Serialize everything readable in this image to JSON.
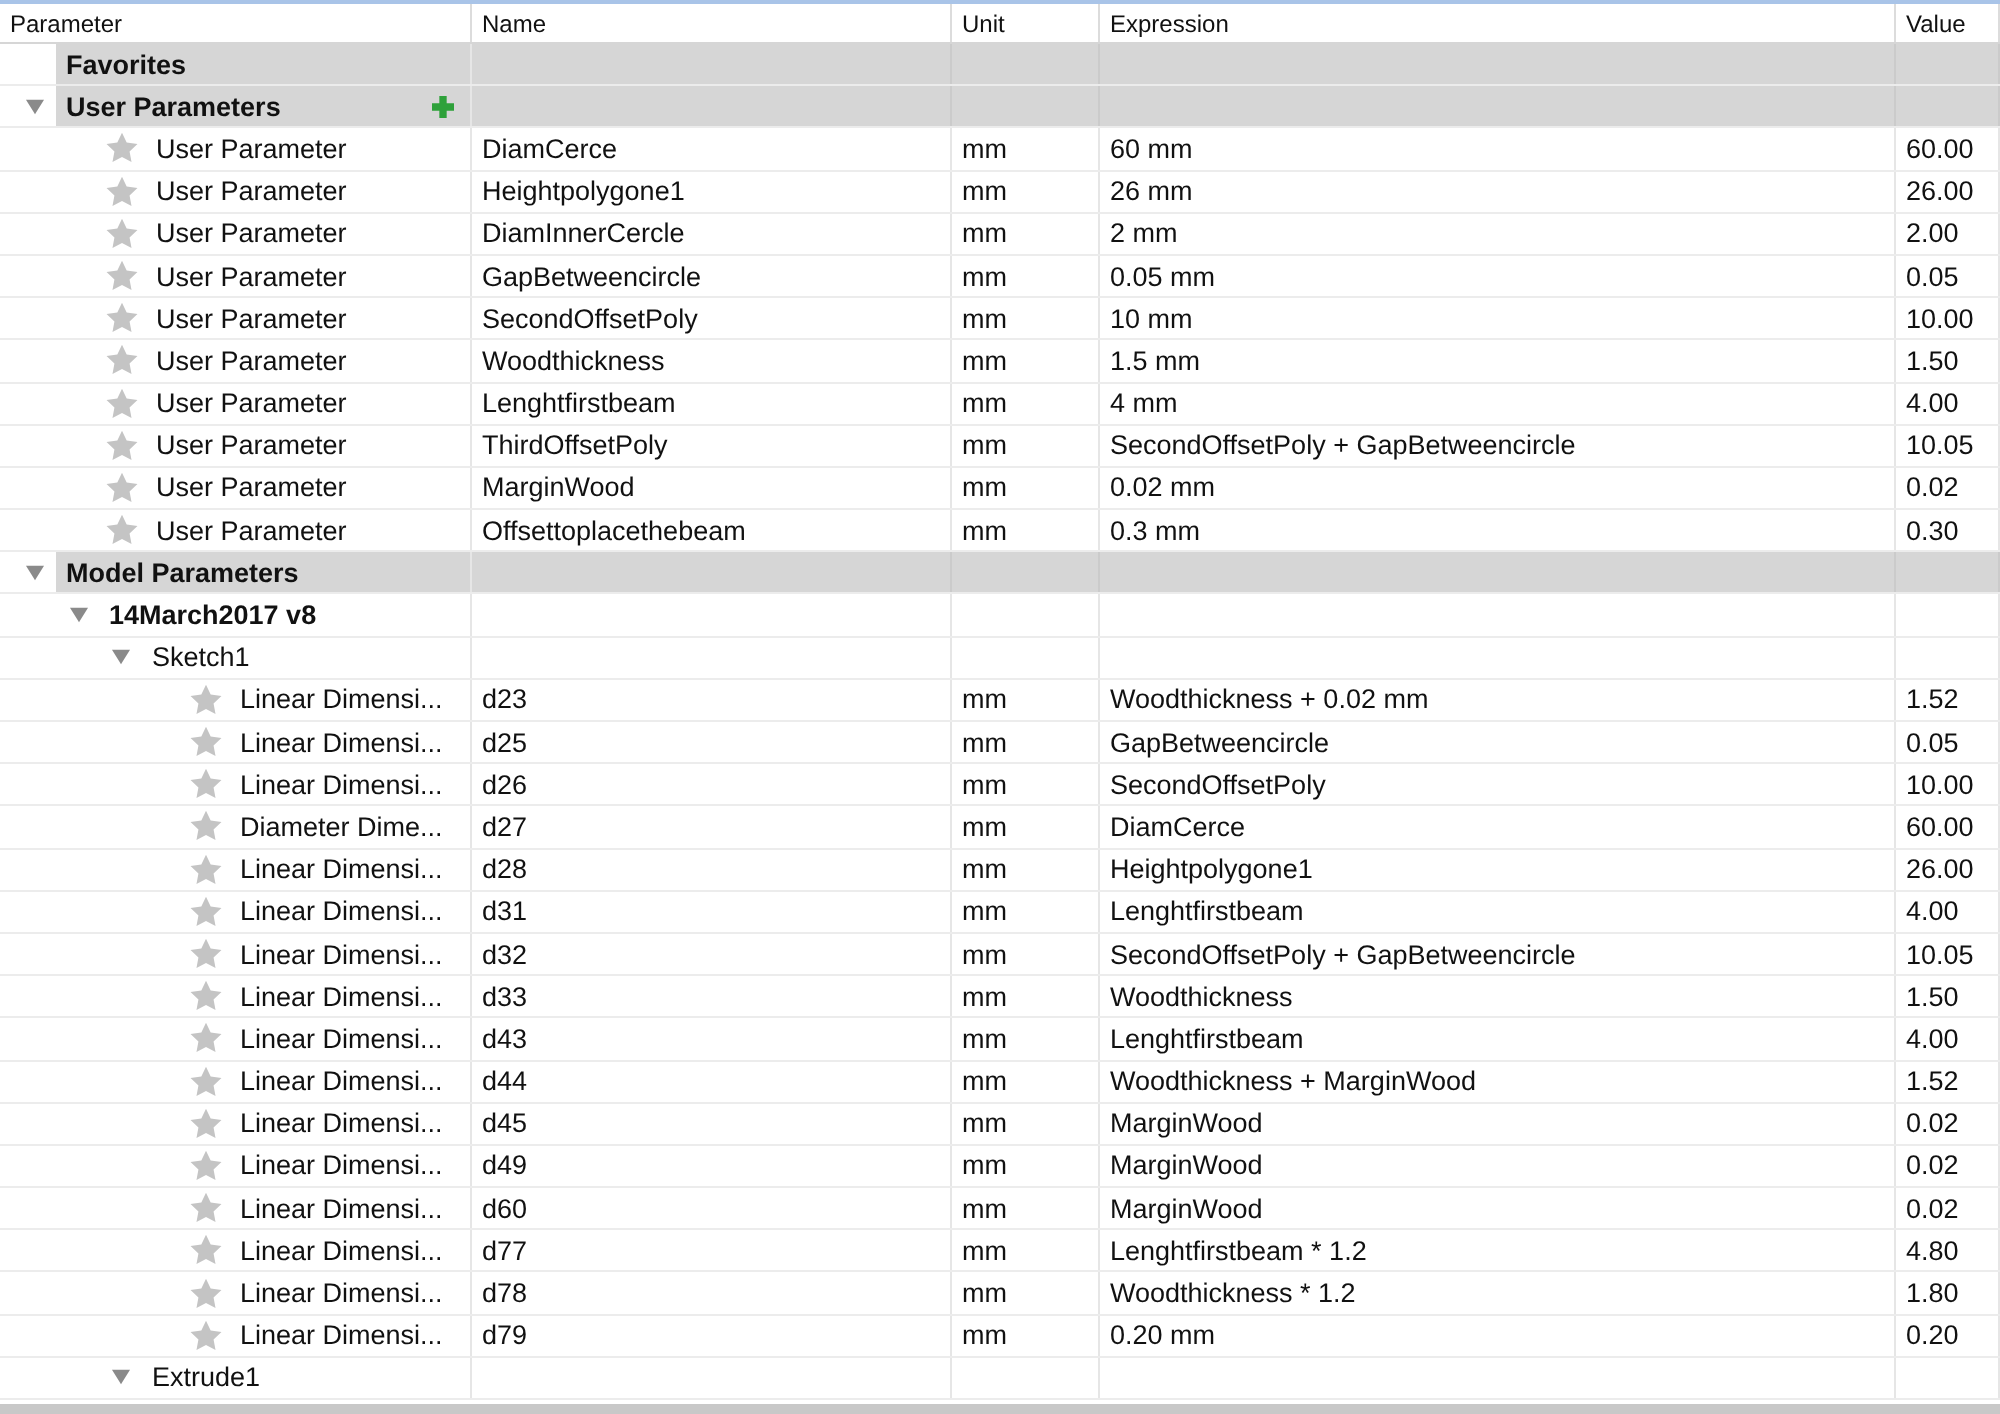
{
  "columns": [
    "Parameter",
    "Name",
    "Unit",
    "Expression",
    "Value"
  ],
  "tree": [
    {
      "kind": "section",
      "label": "Favorites"
    },
    {
      "kind": "section",
      "label": "User Parameters",
      "expanded": true,
      "add_button": true,
      "children": [
        {
          "kind": "param",
          "type": "User Parameter",
          "name": "DiamCerce",
          "unit": "mm",
          "expression": "60 mm",
          "value": "60.00",
          "favorite": false
        },
        {
          "kind": "param",
          "type": "User Parameter",
          "name": "Heightpolygone1",
          "unit": "mm",
          "expression": "26 mm",
          "value": "26.00",
          "favorite": false
        },
        {
          "kind": "param",
          "type": "User Parameter",
          "name": "DiamInnerCercle",
          "unit": "mm",
          "expression": "2 mm",
          "value": "2.00",
          "favorite": false
        },
        {
          "kind": "param",
          "type": "User Parameter",
          "name": "GapBetweencircle",
          "unit": "mm",
          "expression": "0.05 mm",
          "value": "0.05",
          "favorite": false
        },
        {
          "kind": "param",
          "type": "User Parameter",
          "name": "SecondOffsetPoly",
          "unit": "mm",
          "expression": "10 mm",
          "value": "10.00",
          "favorite": false
        },
        {
          "kind": "param",
          "type": "User Parameter",
          "name": "Woodthickness",
          "unit": "mm",
          "expression": "1.5 mm",
          "value": "1.50",
          "favorite": false
        },
        {
          "kind": "param",
          "type": "User Parameter",
          "name": "Lenghtfirstbeam",
          "unit": "mm",
          "expression": "4 mm",
          "value": "4.00",
          "favorite": false
        },
        {
          "kind": "param",
          "type": "User Parameter",
          "name": "ThirdOffsetPoly",
          "unit": "mm",
          "expression": "SecondOffsetPoly + GapBetweencircle",
          "value": "10.05",
          "favorite": false
        },
        {
          "kind": "param",
          "type": "User Parameter",
          "name": "MarginWood",
          "unit": "mm",
          "expression": "0.02 mm",
          "value": "0.02",
          "favorite": false
        },
        {
          "kind": "param",
          "type": "User Parameter",
          "name": "Offsettoplacethebeam",
          "unit": "mm",
          "expression": "0.3 mm",
          "value": "0.30",
          "favorite": false
        }
      ]
    },
    {
      "kind": "section",
      "label": "Model Parameters",
      "expanded": true,
      "children": [
        {
          "kind": "component",
          "label": "14March2017 v8",
          "expanded": true,
          "children": [
            {
              "kind": "feature",
              "label": "Sketch1",
              "expanded": true,
              "children": [
                {
                  "kind": "param",
                  "type": "Linear Dimensi...",
                  "name": "d23",
                  "unit": "mm",
                  "expression": "Woodthickness + 0.02 mm",
                  "value": "1.52",
                  "favorite": false
                },
                {
                  "kind": "param",
                  "type": "Linear Dimensi...",
                  "name": "d25",
                  "unit": "mm",
                  "expression": "GapBetweencircle",
                  "value": "0.05",
                  "favorite": false
                },
                {
                  "kind": "param",
                  "type": "Linear Dimensi...",
                  "name": "d26",
                  "unit": "mm",
                  "expression": "SecondOffsetPoly",
                  "value": "10.00",
                  "favorite": false
                },
                {
                  "kind": "param",
                  "type": "Diameter Dime...",
                  "name": "d27",
                  "unit": "mm",
                  "expression": "DiamCerce",
                  "value": "60.00",
                  "favorite": false
                },
                {
                  "kind": "param",
                  "type": "Linear Dimensi...",
                  "name": "d28",
                  "unit": "mm",
                  "expression": "Heightpolygone1",
                  "value": "26.00",
                  "favorite": false
                },
                {
                  "kind": "param",
                  "type": "Linear Dimensi...",
                  "name": "d31",
                  "unit": "mm",
                  "expression": "Lenghtfirstbeam",
                  "value": "4.00",
                  "favorite": false
                },
                {
                  "kind": "param",
                  "type": "Linear Dimensi...",
                  "name": "d32",
                  "unit": "mm",
                  "expression": "SecondOffsetPoly + GapBetweencircle",
                  "value": "10.05",
                  "favorite": false
                },
                {
                  "kind": "param",
                  "type": "Linear Dimensi...",
                  "name": "d33",
                  "unit": "mm",
                  "expression": "Woodthickness",
                  "value": "1.50",
                  "favorite": false
                },
                {
                  "kind": "param",
                  "type": "Linear Dimensi...",
                  "name": "d43",
                  "unit": "mm",
                  "expression": "Lenghtfirstbeam",
                  "value": "4.00",
                  "favorite": false
                },
                {
                  "kind": "param",
                  "type": "Linear Dimensi...",
                  "name": "d44",
                  "unit": "mm",
                  "expression": "Woodthickness + MarginWood",
                  "value": "1.52",
                  "favorite": false
                },
                {
                  "kind": "param",
                  "type": "Linear Dimensi...",
                  "name": "d45",
                  "unit": "mm",
                  "expression": "MarginWood",
                  "value": "0.02",
                  "favorite": false
                },
                {
                  "kind": "param",
                  "type": "Linear Dimensi...",
                  "name": "d49",
                  "unit": "mm",
                  "expression": "MarginWood",
                  "value": "0.02",
                  "favorite": false
                },
                {
                  "kind": "param",
                  "type": "Linear Dimensi...",
                  "name": "d60",
                  "unit": "mm",
                  "expression": "MarginWood",
                  "value": "0.02",
                  "favorite": false
                },
                {
                  "kind": "param",
                  "type": "Linear Dimensi...",
                  "name": "d77",
                  "unit": "mm",
                  "expression": "Lenghtfirstbeam * 1.2",
                  "value": "4.80",
                  "favorite": false
                },
                {
                  "kind": "param",
                  "type": "Linear Dimensi...",
                  "name": "d78",
                  "unit": "mm",
                  "expression": "Woodthickness * 1.2",
                  "value": "1.80",
                  "favorite": false
                },
                {
                  "kind": "param",
                  "type": "Linear Dimensi...",
                  "name": "d79",
                  "unit": "mm",
                  "expression": "0.20 mm",
                  "value": "0.20",
                  "favorite": false
                }
              ]
            },
            {
              "kind": "feature",
              "label": "Extrude1",
              "expanded": true
            }
          ]
        }
      ]
    }
  ]
}
